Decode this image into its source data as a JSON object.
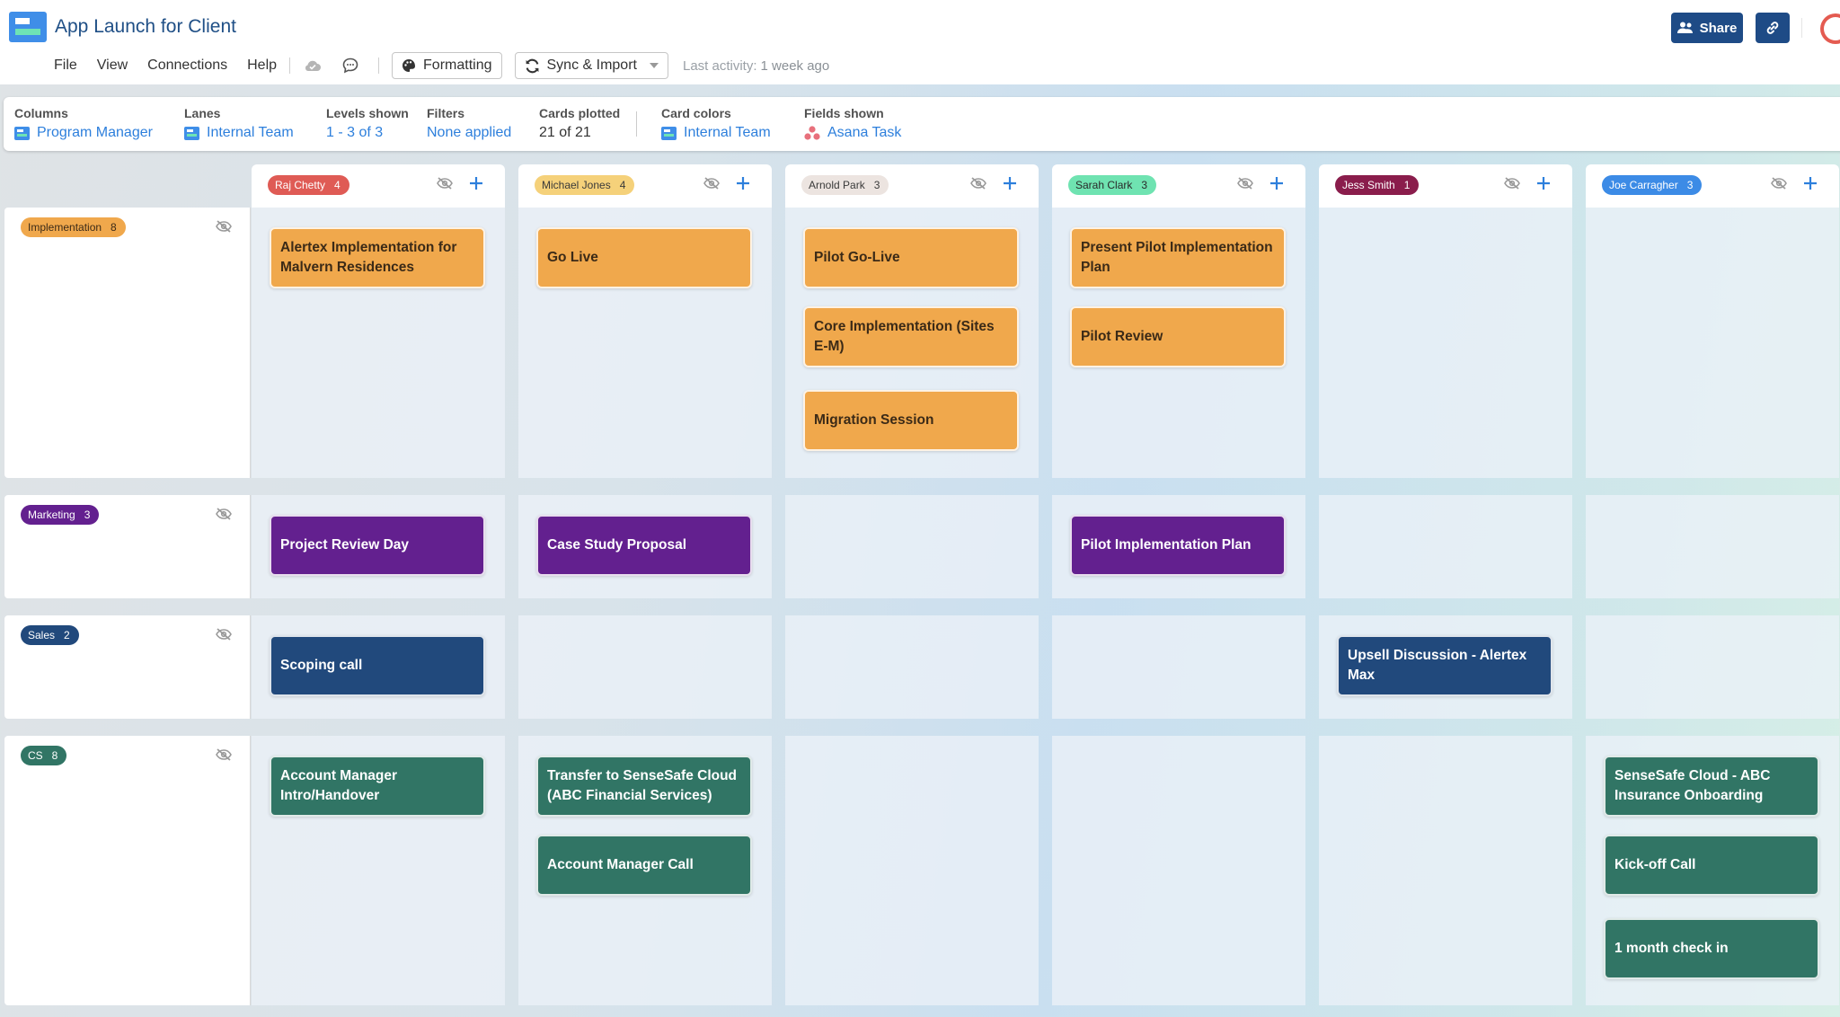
{
  "app": {
    "title": "App Launch for Client",
    "logo_icon": "board-logo-icon"
  },
  "menu": {
    "items": [
      "File",
      "View",
      "Connections",
      "Help"
    ],
    "cloud_icon": "cloud-check-icon",
    "comment_icon": "comment-icon",
    "formatting_label": "Formatting",
    "sync_label": "Sync & Import",
    "last_activity_label": "Last activity:",
    "last_activity_value": "1 week ago"
  },
  "header_actions": {
    "share_label": "Share",
    "share_icon": "users-icon",
    "link_icon": "link-icon",
    "loading_icon": "loading-spinner-icon"
  },
  "settings": {
    "columns": {
      "label": "Columns",
      "value": "Program Manager"
    },
    "lanes": {
      "label": "Lanes",
      "value": "Internal Team"
    },
    "levels": {
      "label": "Levels shown",
      "value": "1 - 3 of 3"
    },
    "filters": {
      "label": "Filters",
      "value": "None applied"
    },
    "cards_plotted": {
      "label": "Cards plotted",
      "value": "21 of 21"
    },
    "card_colors": {
      "label": "Card colors",
      "value": "Internal Team"
    },
    "fields_shown": {
      "label": "Fields shown",
      "value": "Asana Task"
    }
  },
  "columns": [
    {
      "name": "Raj Chetty",
      "count": "4",
      "bg": "#df5b55",
      "fg": "#ffffff"
    },
    {
      "name": "Michael Jones",
      "count": "4",
      "bg": "#f5d17a",
      "fg": "#3a3a3a"
    },
    {
      "name": "Arnold Park",
      "count": "3",
      "bg": "#ece4e0",
      "fg": "#3a3a3a"
    },
    {
      "name": "Sarah Clark",
      "count": "3",
      "bg": "#6fe3b1",
      "fg": "#2a2a2a"
    },
    {
      "name": "Jess Smith",
      "count": "1",
      "bg": "#8a1d4c",
      "fg": "#ffffff"
    },
    {
      "name": "Joe Carragher",
      "count": "3",
      "bg": "#3c8be6",
      "fg": "#ffffff"
    }
  ],
  "lanes": [
    {
      "name": "Implementation",
      "count": "8",
      "bg": "#f0a84c",
      "fg": "#3b2a17"
    },
    {
      "name": "Marketing",
      "count": "3",
      "bg": "#63208f",
      "fg": "#ffffff"
    },
    {
      "name": "Sales",
      "count": "2",
      "bg": "#21497c",
      "fg": "#ffffff"
    },
    {
      "name": "CS",
      "count": "8",
      "bg": "#317565",
      "fg": "#ffffff"
    }
  ],
  "cards": {
    "implementation": [
      [
        "Alertex Implementation for Malvern Residences"
      ],
      [
        "Go Live"
      ],
      [
        "Pilot Go-Live",
        "Core Implementation (Sites E-M)",
        "Migration Session"
      ],
      [
        "Present Pilot Implementation Plan",
        "Pilot Review"
      ],
      [],
      []
    ],
    "marketing": [
      [
        "Project Review Day"
      ],
      [
        "Case Study Proposal"
      ],
      [],
      [
        "Pilot Implementation Plan"
      ],
      [],
      []
    ],
    "sales": [
      [
        "Scoping call"
      ],
      [],
      [],
      [],
      [
        "Upsell Discussion - Alertex Max"
      ],
      []
    ],
    "cs": [
      [
        "Account Manager Intro/Handover"
      ],
      [
        "Transfer to SenseSafe Cloud (ABC Financial Services)",
        "Account Manager Call"
      ],
      [],
      [],
      [],
      [
        "SenseSafe Cloud - ABC Insurance Onboarding",
        "Kick-off Call",
        "1 month check in"
      ]
    ]
  }
}
